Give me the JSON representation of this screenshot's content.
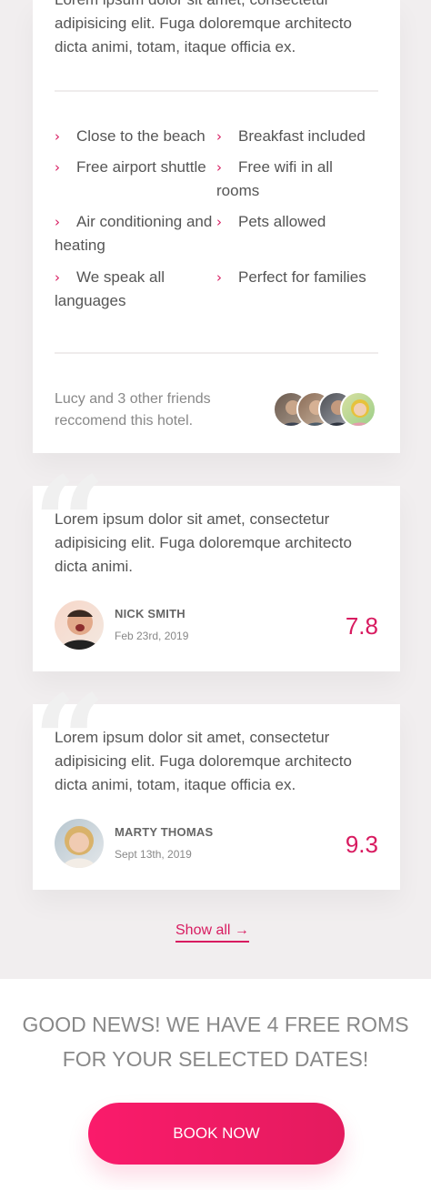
{
  "hotel": {
    "description": "Lorem ipsum dolor sit amet, consectetur adipisicing elit. Fuga doloremque architecto dicta animi, totam, itaque officia ex.",
    "amenities": [
      "Close to the beach",
      "Breakfast included",
      "Free airport shuttle",
      "Free wifi in all rooms",
      "Air conditioning and heating",
      "Pets allowed",
      "We speak all languages",
      "Perfect for families"
    ],
    "friends_text": "Lucy and 3 other friends reccomend this hotel.",
    "amenity_icon": "chevron-right-icon"
  },
  "reviews": [
    {
      "text": "Lorem ipsum dolor sit amet, consectetur adipisicing elit. Fuga doloremque architecto dicta animi.",
      "name": "NICK SMITH",
      "date": "Feb 23rd, 2019",
      "score": "7.8"
    },
    {
      "text": "Lorem ipsum dolor sit amet, consectetur adipisicing elit. Fuga doloremque architecto dicta animi, totam, itaque officia ex.",
      "name": "MARTY THOMAS",
      "date": "Sept 13th, 2019",
      "score": "9.3"
    }
  ],
  "show_all": "Show all →",
  "availability": {
    "message": "GOOD NEWS! WE HAVE 4 FREE ROMS FOR YOUR SELECTED DATES!",
    "button": "BOOK NOW"
  },
  "colors": {
    "accent": "#d81b60",
    "button_start": "#fa1b6b",
    "button_end": "#e41b5e",
    "page_bg": "#f1eeef"
  }
}
